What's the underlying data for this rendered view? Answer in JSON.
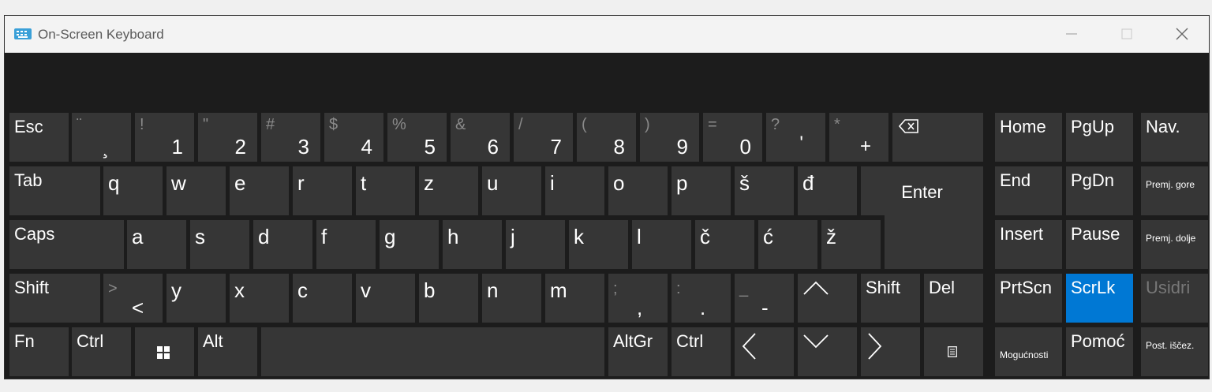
{
  "window": {
    "title": "On-Screen Keyboard",
    "icon": "keyboard-app-icon",
    "controls": [
      "minimize-icon",
      "maximize-icon",
      "close-icon"
    ]
  },
  "colors": {
    "key_bg": "#363636",
    "key_active": "#0078d4",
    "panel_bg": "#1c1c1c",
    "titlebar_bg": "#f3f3f3"
  },
  "rows": {
    "number_row": [
      {
        "secondary": "¨",
        "primary": "¸"
      },
      {
        "secondary": "!",
        "primary": "1"
      },
      {
        "secondary": "\"",
        "primary": "2"
      },
      {
        "secondary": "#",
        "primary": "3"
      },
      {
        "secondary": "$",
        "primary": "4"
      },
      {
        "secondary": "%",
        "primary": "5"
      },
      {
        "secondary": "&",
        "primary": "6"
      },
      {
        "secondary": "/",
        "primary": "7"
      },
      {
        "secondary": "(",
        "primary": "8"
      },
      {
        "secondary": ")",
        "primary": "9"
      },
      {
        "secondary": "=",
        "primary": "0"
      },
      {
        "secondary": "?",
        "primary": "'"
      },
      {
        "secondary": "*",
        "primary": "+"
      }
    ],
    "q_row": [
      "q",
      "w",
      "e",
      "r",
      "t",
      "z",
      "u",
      "i",
      "o",
      "p",
      "š",
      "đ"
    ],
    "a_row": [
      "a",
      "s",
      "d",
      "f",
      "g",
      "h",
      "j",
      "k",
      "l",
      "č",
      "ć",
      "ž"
    ],
    "z_row_letters": [
      "y",
      "x",
      "c",
      "v",
      "b",
      "n",
      "m"
    ],
    "z_row_symbols": [
      {
        "secondary": ";",
        "primary": ","
      },
      {
        "secondary": ":",
        "primary": "."
      },
      {
        "secondary": "_",
        "primary": "-"
      }
    ],
    "angle_key": {
      "secondary": ">",
      "primary": "<"
    }
  },
  "keys": {
    "esc": "Esc",
    "tab": "Tab",
    "caps": "Caps",
    "shift_left": "Shift",
    "shift_right": "Shift",
    "fn": "Fn",
    "ctrl_left": "Ctrl",
    "alt": "Alt",
    "altgr": "AltGr",
    "ctrl_right": "Ctrl",
    "enter": "Enter",
    "del": "Del"
  },
  "nav_keys": {
    "home": "Home",
    "pgup": "PgUp",
    "nav": "Nav.",
    "end": "End",
    "pgdn": "PgDn",
    "premj_gore": "Premj. gore",
    "insert": "Insert",
    "pause": "Pause",
    "premj_dolje": "Premj. dolje",
    "prtscn": "PrtScn",
    "scrlk": "ScrLk",
    "usidri": "Usidri",
    "mogucnosti": "Mogućnosti",
    "pomoc": "Pomoć",
    "post_iscez": "Post. iščez."
  },
  "active_key": "ScrLk",
  "disabled_key": "Usidri"
}
